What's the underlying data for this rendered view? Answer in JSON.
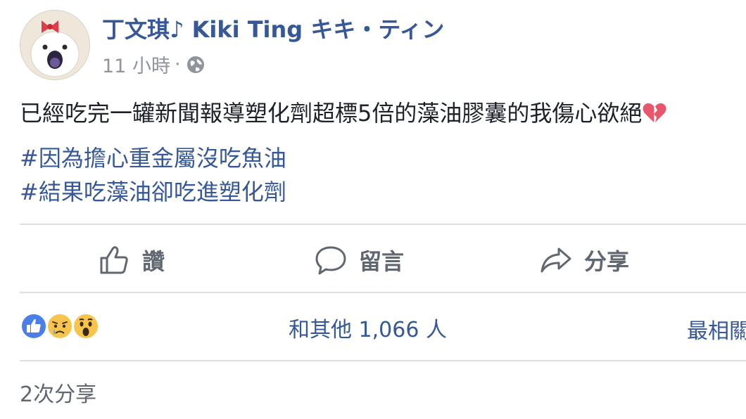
{
  "post": {
    "author": "丁文琪♪ Kiki Ting キキ・ティン",
    "time": "11 小時",
    "separator": "·",
    "privacy_icon": "globe-icon",
    "text": "已經吃完一罐新聞報導塑化劑超標5倍的藻油膠囊的我傷心欲絕",
    "emoji": "broken-heart-icon",
    "hashtags": [
      "#因為擔心重金屬沒吃魚油",
      "#結果吃藻油卻吃進塑化劑"
    ]
  },
  "actions": {
    "like_label": "讚",
    "comment_label": "留言",
    "share_label": "分享"
  },
  "reactions": {
    "icons": [
      "like-reaction-icon",
      "sad-reaction-icon",
      "wow-reaction-icon"
    ],
    "count_text": "和其他 1,066 人",
    "sort_label": "最相關"
  },
  "shares": {
    "count_text": "2次分享"
  },
  "colors": {
    "link": "#365899",
    "meta": "#90949c",
    "text": "#1d2129",
    "divider": "#dddfe2",
    "like_blue": "#4a7ee8",
    "reaction_yellow": "#f7c44d"
  }
}
